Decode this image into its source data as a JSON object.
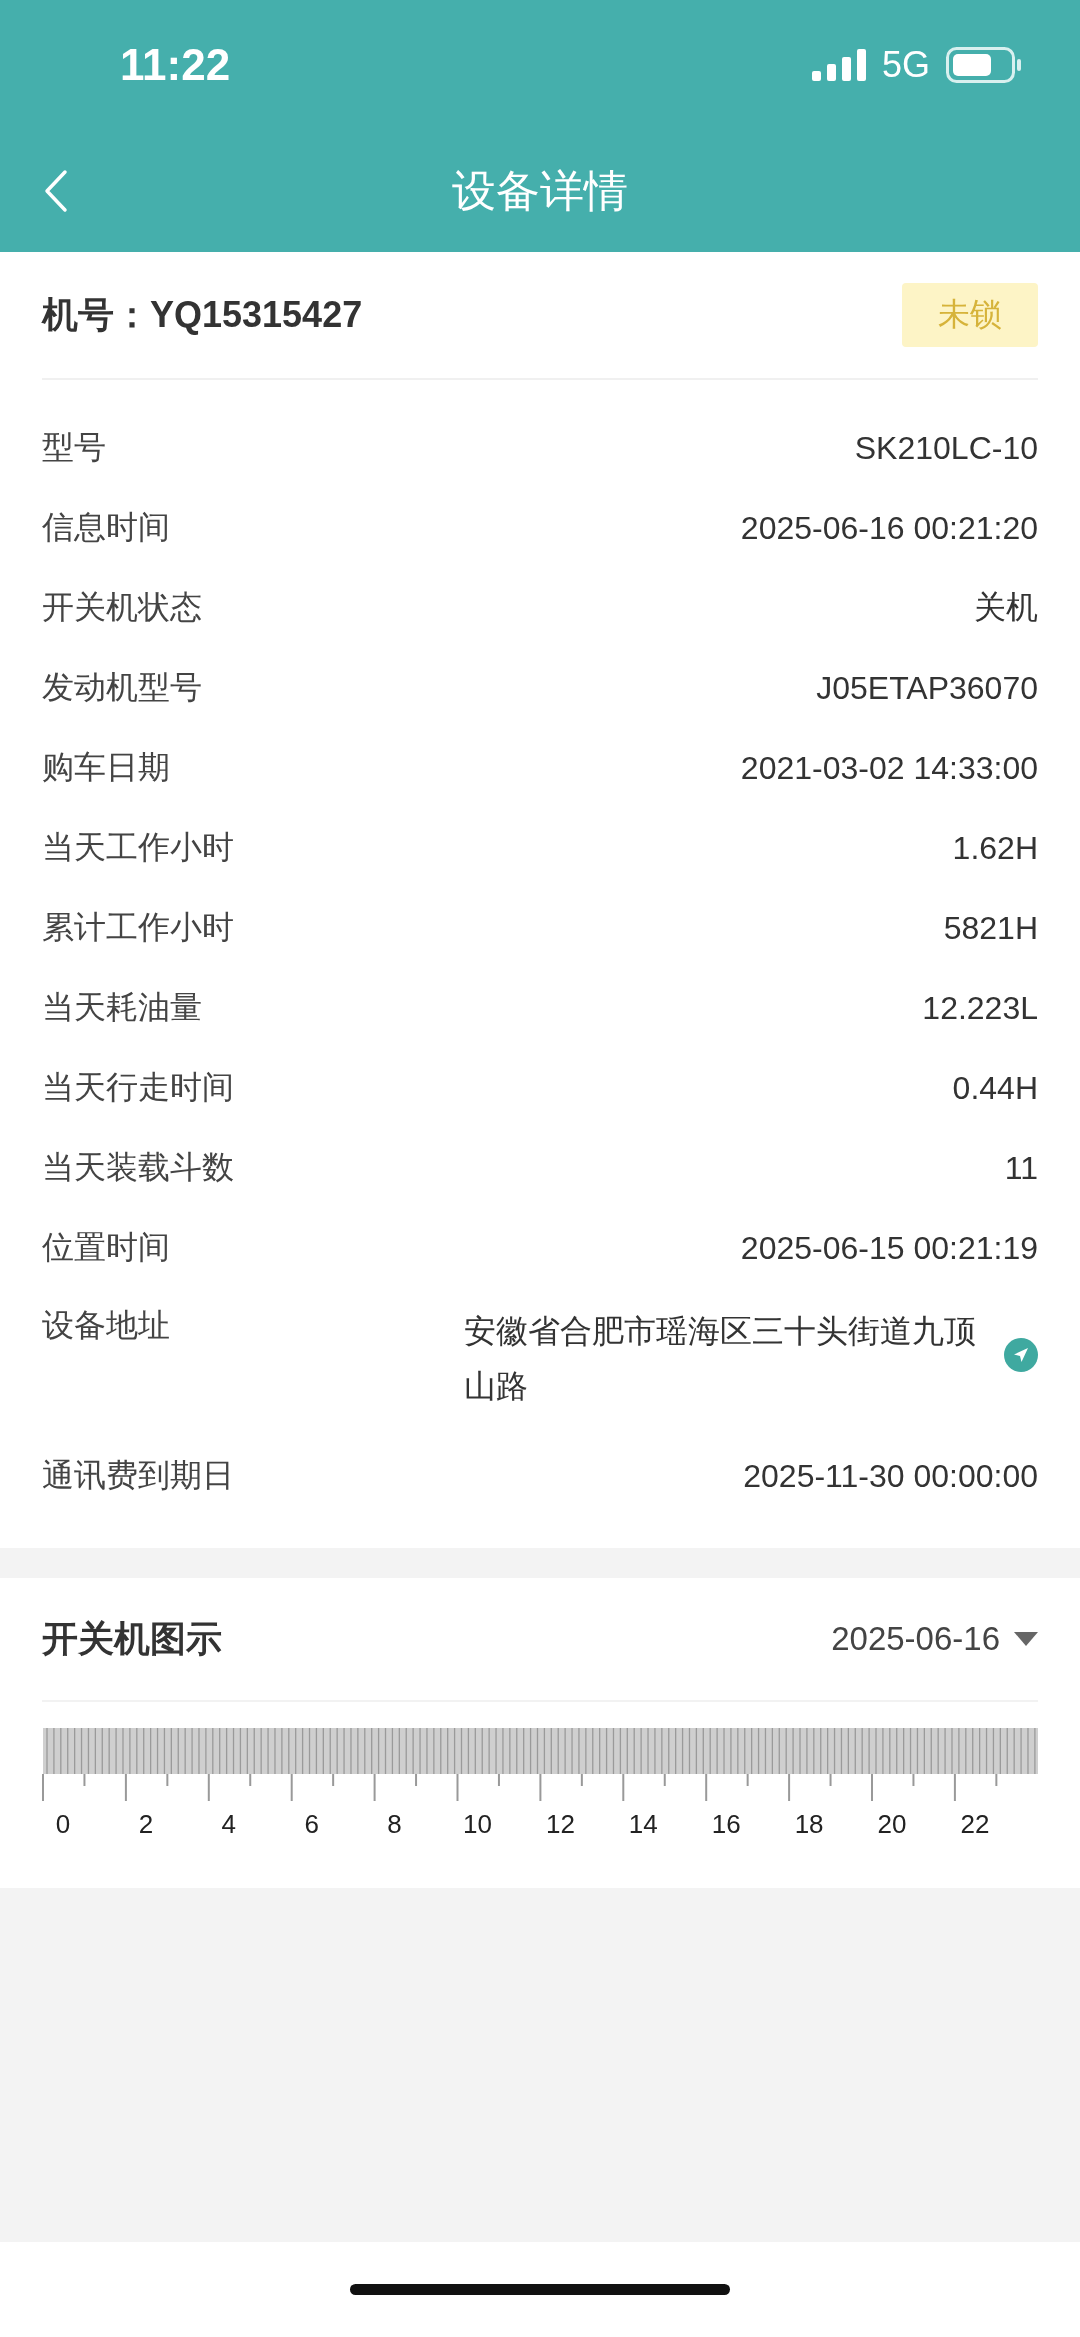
{
  "status_bar": {
    "time": "11:22",
    "network": "5G"
  },
  "nav": {
    "title": "设备详情"
  },
  "device": {
    "number_label": "机号：YQ15315427",
    "lock": {
      "label": "未锁",
      "locked": false
    }
  },
  "fields": [
    {
      "kind": "text",
      "label": "型号",
      "value": "SK210LC-10"
    },
    {
      "kind": "text",
      "label": "信息时间",
      "value": "2025-06-16 00:21:20"
    },
    {
      "kind": "text",
      "label": "开关机状态",
      "value": "关机"
    },
    {
      "kind": "text",
      "label": "发动机型号",
      "value": "J05ETAP36070"
    },
    {
      "kind": "text",
      "label": "购车日期",
      "value": "2021-03-02 14:33:00"
    },
    {
      "kind": "text",
      "label": "当天工作小时",
      "value": "1.62H"
    },
    {
      "kind": "text",
      "label": "累计工作小时",
      "value": "5821H"
    },
    {
      "kind": "text",
      "label": "当天耗油量",
      "value": "12.223L"
    },
    {
      "kind": "text",
      "label": "当天行走时间",
      "value": "0.44H"
    },
    {
      "kind": "text",
      "label": "当天装载斗数",
      "value": "11"
    },
    {
      "kind": "text",
      "label": "位置时间",
      "value": "2025-06-15 00:21:19"
    },
    {
      "kind": "address",
      "label": "设备地址",
      "value": "安徽省合肥市瑶海区三十头街道九顶山路"
    },
    {
      "kind": "text",
      "label": "通讯费到期日",
      "value": "2025-11-30 00:00:00"
    }
  ],
  "power_chart": {
    "title": "开关机图示",
    "date": "2025-06-16",
    "hour_labels": [
      "0",
      "2",
      "4",
      "6",
      "8",
      "10",
      "12",
      "14",
      "16",
      "18",
      "20",
      "22"
    ]
  }
}
